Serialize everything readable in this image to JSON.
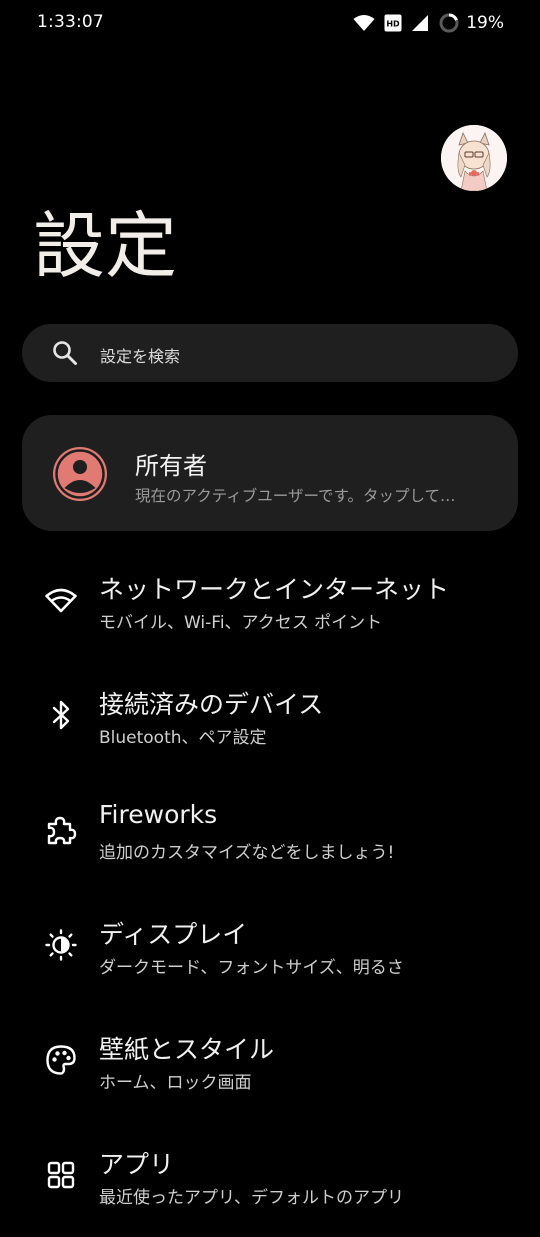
{
  "status_bar": {
    "time": "1:33:07",
    "network_badge": "HD",
    "battery_percent": "19%",
    "battery_level": 0.19,
    "icons": [
      "wifi-icon",
      "hd-icon",
      "cell-signal-icon",
      "battery-ring-icon"
    ]
  },
  "header": {
    "title": "設定",
    "avatar_icon": "profile-avatar"
  },
  "search": {
    "placeholder": "設定を検索",
    "icon": "search-icon"
  },
  "owner_card": {
    "name": "所有者",
    "subtitle": "現在のアクティブユーザーです。タップして…",
    "icon": "user-avatar-icon",
    "accent_color": "#e07a72"
  },
  "menu": {
    "items": [
      {
        "title": "ネットワークとインターネット",
        "subtitle": "モバイル、Wi-Fi、アクセス ポイント",
        "icon": "wifi-icon"
      },
      {
        "title": "接続済みのデバイス",
        "subtitle": "Bluetooth、ペア設定",
        "icon": "bluetooth-icon"
      },
      {
        "title": "Fireworks",
        "subtitle": "追加のカスタマイズなどをしましょう!",
        "icon": "puzzle-icon"
      },
      {
        "title": "ディスプレイ",
        "subtitle": "ダークモード、フォントサイズ、明るさ",
        "icon": "brightness-icon"
      },
      {
        "title": "壁紙とスタイル",
        "subtitle": "ホーム、ロック画面",
        "icon": "palette-icon"
      },
      {
        "title": "アプリ",
        "subtitle": "最近使ったアプリ、デフォルトのアプリ",
        "icon": "apps-grid-icon"
      }
    ]
  },
  "colors": {
    "background": "#000000",
    "surface": "#1f1f1f",
    "title_text": "#f1ede8",
    "secondary_text": "#9b9b9b"
  }
}
